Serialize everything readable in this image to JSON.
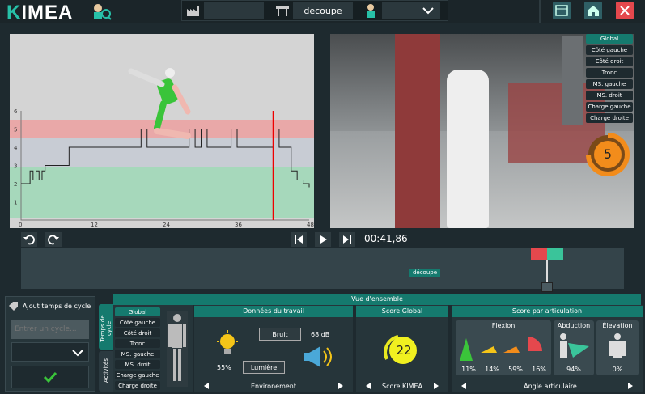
{
  "app": {
    "logo_prefix": "K",
    "logo_rest": "IMEA"
  },
  "header": {
    "factory_value": "",
    "operation_value": "decoupe",
    "operator_value": ""
  },
  "viewer": {
    "y_ticks": [
      "1",
      "2",
      "3",
      "4",
      "5",
      "6"
    ],
    "x_ticks": [
      "0",
      "12",
      "24",
      "36",
      "48"
    ]
  },
  "chart_data": {
    "type": "line",
    "x": [
      0,
      1,
      1.5,
      2,
      2.5,
      3,
      3.5,
      4,
      5,
      6,
      7,
      8,
      9,
      10,
      11,
      12,
      13,
      14,
      15,
      16,
      17,
      18,
      19,
      20,
      21,
      22,
      23,
      24,
      25,
      26,
      27,
      28,
      29,
      30,
      31,
      32,
      33,
      34,
      35,
      36,
      37,
      38,
      39,
      40,
      41,
      42,
      43,
      44,
      45,
      46,
      47,
      48
    ],
    "y": [
      2,
      2,
      2.7,
      2.2,
      2.7,
      2.2,
      2.7,
      3,
      3,
      3,
      3,
      4,
      4,
      4,
      4,
      4,
      4,
      4,
      4,
      4,
      4,
      4,
      4,
      5,
      4,
      4,
      4,
      4,
      4,
      4,
      4,
      5,
      4,
      5,
      4,
      4,
      4,
      4,
      5,
      4,
      4,
      4,
      4,
      4,
      4,
      5,
      4,
      4,
      2.7,
      2.2,
      2,
      1.8
    ],
    "xlim": [
      0,
      48
    ],
    "ylim": [
      0,
      6
    ],
    "cursor_x": 42
  },
  "body_parts": [
    "Global",
    "Côté gauche",
    "Côté droit",
    "Tronc",
    "MS. gauche",
    "MS. droit",
    "Charge gauche",
    "Charge droite"
  ],
  "video": {
    "score": "5"
  },
  "controls": {
    "time": "00:41,86"
  },
  "timeline": {
    "segment_label": "découpe"
  },
  "left": {
    "add_cycle_label": "Ajout temps de cycle",
    "cycle_placeholder": "Entrer un cycle..."
  },
  "tabs": {
    "cycle": "Temps de cycle",
    "activities": "Activités"
  },
  "overview": {
    "title": "Vue d'ensemble"
  },
  "work": {
    "title": "Données du travail",
    "noise_label": "Bruit",
    "noise_value": "68 dB",
    "light_pct": "55%",
    "light_label": "Lumière",
    "footer": "Environement"
  },
  "score": {
    "title": "Score Global",
    "value": "22",
    "footer": "Score KIMEA"
  },
  "joints": {
    "title": "Score par articulation",
    "flexion": "Flexion",
    "abduction": "Abduction",
    "elevation": "Élevation",
    "flex_values": [
      "11%",
      "14%",
      "59%",
      "16%"
    ],
    "abd_value": "94%",
    "elev_value": "0%",
    "footer": "Angle articulaire"
  }
}
